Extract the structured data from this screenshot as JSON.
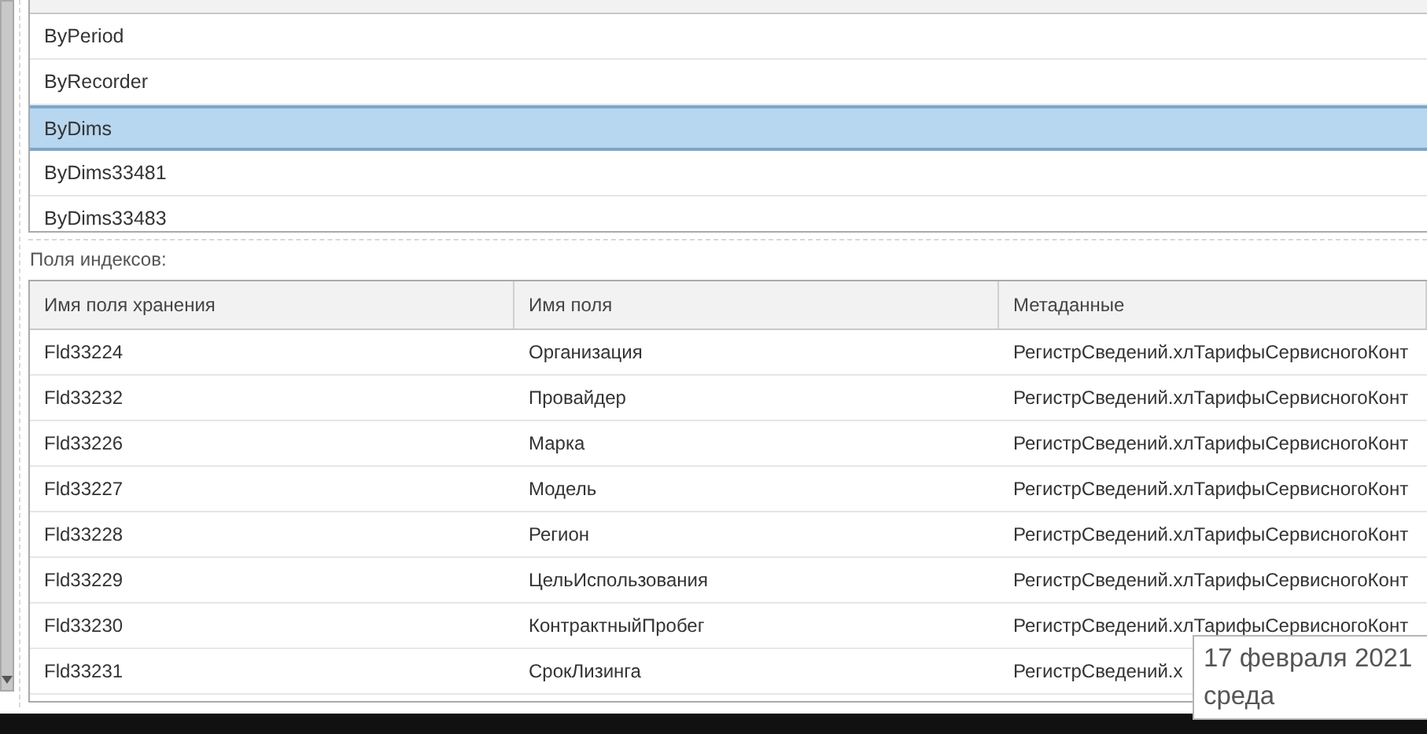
{
  "indexes": [
    {
      "name": "ByPeriod",
      "selected": false
    },
    {
      "name": "ByRecorder",
      "selected": false
    },
    {
      "name": "ByDims",
      "selected": true
    },
    {
      "name": "ByDims33481",
      "selected": false
    },
    {
      "name": "ByDims33483",
      "selected": false
    }
  ],
  "index_fields_label": "Поля индексов:",
  "fields_table": {
    "columns": [
      "Имя поля хранения",
      "Имя поля",
      "Метаданные"
    ],
    "rows": [
      [
        "Fld33224",
        "Организация",
        "РегистрСведений.хлТарифыСервисногоКонт"
      ],
      [
        "Fld33232",
        "Провайдер",
        "РегистрСведений.хлТарифыСервисногоКонт"
      ],
      [
        "Fld33226",
        "Марка",
        "РегистрСведений.хлТарифыСервисногоКонт"
      ],
      [
        "Fld33227",
        "Модель",
        "РегистрСведений.хлТарифыСервисногоКонт"
      ],
      [
        "Fld33228",
        "Регион",
        "РегистрСведений.хлТарифыСервисногоКонт"
      ],
      [
        "Fld33229",
        "ЦельИспользования",
        "РегистрСведений.хлТарифыСервисногоКонт"
      ],
      [
        "Fld33230",
        "КонтрактныйПробег",
        "РегистрСведений.хлТарифыСервисногоКонт"
      ],
      [
        "Fld33231",
        "СрокЛизинга",
        "РегистрСведений.х"
      ]
    ]
  },
  "tooltip": {
    "date": "17 февраля 2021",
    "weekday": "среда"
  }
}
